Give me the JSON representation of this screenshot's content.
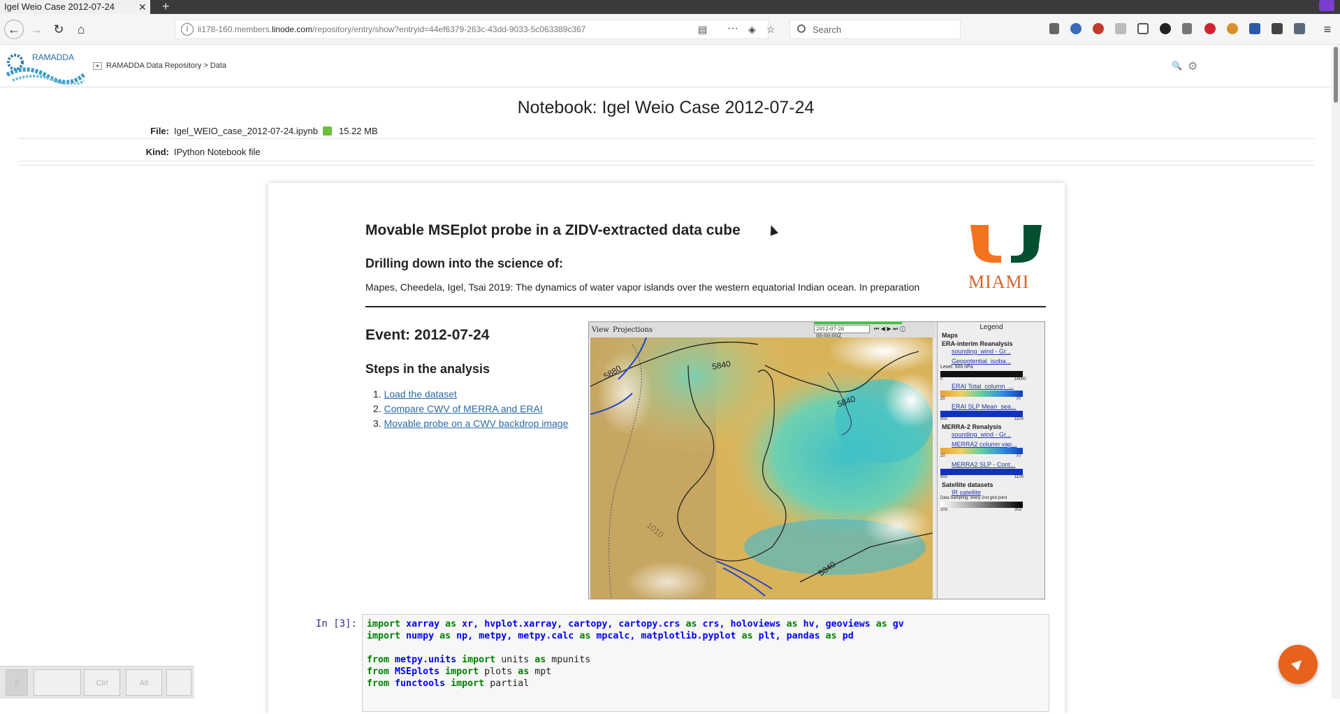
{
  "browser": {
    "tab_title": "Igel Weio Case 2012-07-24",
    "url_prefix": "li178-160.members.",
    "url_domain": "linode.com",
    "url_path": "/repository/entry/show?entryid=44ef6379-263c-43dd-9033-5c063389c367",
    "search_placeholder": "Search"
  },
  "header": {
    "logo_text": "RAMADDA",
    "breadcrumb": "RAMADDA Data Repository > Data"
  },
  "entry": {
    "title": "Notebook: Igel Weio Case 2012-07-24",
    "file_label": "File:",
    "file_name": "Igel_WEIO_case_2012-07-24.ipynb",
    "file_size": "15.22 MB",
    "kind_label": "Kind:",
    "kind_value": "IPython Notebook file"
  },
  "notebook": {
    "heading": "Movable MSEplot probe in a ZIDV-extracted data cube",
    "subheading": "Drilling down into the science of:",
    "citation": "Mapes, Cheedela, Igel, Tsai 2019: The dynamics of water vapor islands over the western equatorial Indian ocean. In preparation",
    "logo_text": "MIAMI",
    "event": "Event: 2012-07-24",
    "steps_title": "Steps in the analysis",
    "steps": [
      {
        "num": "1.",
        "label": "Load the dataset"
      },
      {
        "num": "2.",
        "label": "Compare CWV of MERRA and ERAI"
      },
      {
        "num": "3.",
        "label": "Movable probe on a CWV backdrop image"
      }
    ],
    "idv": {
      "menu_view": "View",
      "menu_projections": "Projections",
      "timestamp": "2012-07-26 00:00:00Z",
      "legend_title": "Legend",
      "legend": [
        "Maps",
        "ERA-interim Reanalysis",
        "sounding_wind - Gr...",
        "Geopotential_isoba...",
        "Level: 500 hPa",
        "0",
        "16000",
        "ERAI Total_column_...",
        "20",
        "70",
        "ERAI SLP Mean_sea...",
        "900",
        "1100",
        "MERRA-2 Renalysis",
        "sounding_wind - Gr...",
        "MERRA2 column vap...",
        "20",
        "70",
        "MERRA2 SLP - Cont...",
        "900",
        "1100",
        "Satellite datasets",
        "IR satellite",
        "Data Sampling: every 2nd grid point",
        "203",
        "303"
      ],
      "contour_labels": [
        "5880",
        "5840",
        "5840",
        "5840",
        "1010"
      ]
    },
    "cell_prompt": "In [3]:",
    "code": {
      "l1": [
        "import",
        "xarray",
        "as",
        "xr,",
        "hvplot.xarray,",
        "cartopy,",
        "cartopy.crs",
        "as",
        "crs,",
        "holoviews",
        "as",
        "hv,",
        "geoviews",
        "as",
        "gv"
      ],
      "l2": [
        "import",
        "numpy",
        "as",
        "np,",
        "metpy,",
        "metpy.calc",
        "as",
        "mpcalc,",
        "matplotlib.pyplot",
        "as",
        "plt,",
        "pandas",
        "as",
        "pd"
      ],
      "l3": [
        "from",
        "metpy.units",
        "import",
        "units",
        "as",
        "mpunits"
      ],
      "l4": [
        "from",
        "MSEplots",
        "import",
        "plots",
        "as",
        "mpt"
      ],
      "l5": [
        "from",
        "functools",
        "import",
        "partial"
      ]
    }
  },
  "keyboard": {
    "ctrl": "Ctrl",
    "alt": "Alt"
  },
  "colors": {
    "orange": "#e8621e",
    "link": "#2a6aa6",
    "um_green": "#005030",
    "um_orange": "#f47321"
  }
}
